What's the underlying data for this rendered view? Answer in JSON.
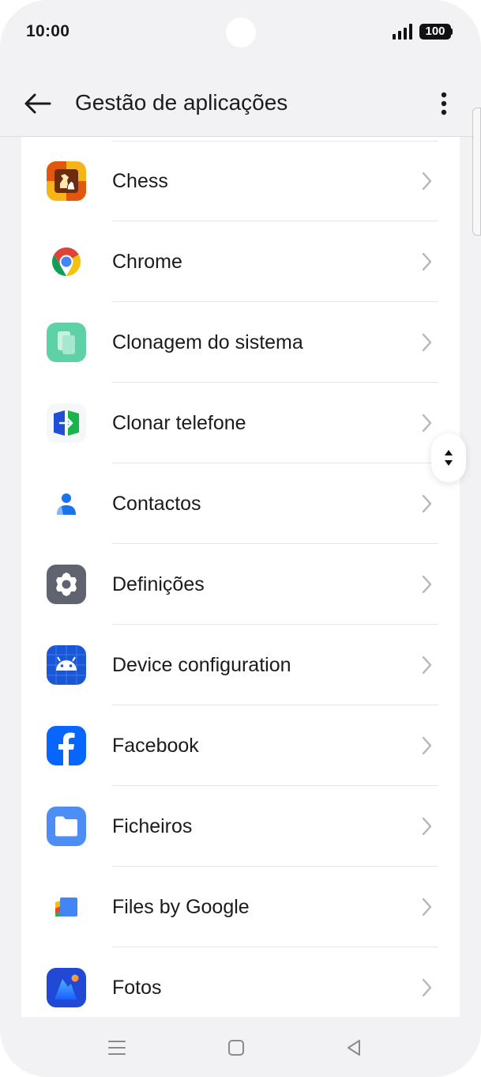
{
  "status_bar": {
    "time": "10:00",
    "battery": "100"
  },
  "header": {
    "title": "Gestão de aplicações"
  },
  "apps": [
    {
      "label": "Chess",
      "icon": "chess-icon"
    },
    {
      "label": "Chrome",
      "icon": "chrome-icon"
    },
    {
      "label": "Clonagem do sistema",
      "icon": "system-clone-icon"
    },
    {
      "label": "Clonar telefone",
      "icon": "clone-phone-icon"
    },
    {
      "label": "Contactos",
      "icon": "contacts-icon"
    },
    {
      "label": "Definições",
      "icon": "settings-gear-icon"
    },
    {
      "label": "Device configuration",
      "icon": "android-icon"
    },
    {
      "label": "Facebook",
      "icon": "facebook-icon"
    },
    {
      "label": "Ficheiros",
      "icon": "folder-icon"
    },
    {
      "label": "Files by Google",
      "icon": "files-by-google-icon"
    },
    {
      "label": "Fotos",
      "icon": "photos-icon"
    }
  ],
  "colors": {
    "background": "#f2f2f4",
    "card": "#ffffff",
    "text": "#1b1b1b",
    "chevron": "#b5b5b8",
    "divider": "#e6e6e8"
  }
}
